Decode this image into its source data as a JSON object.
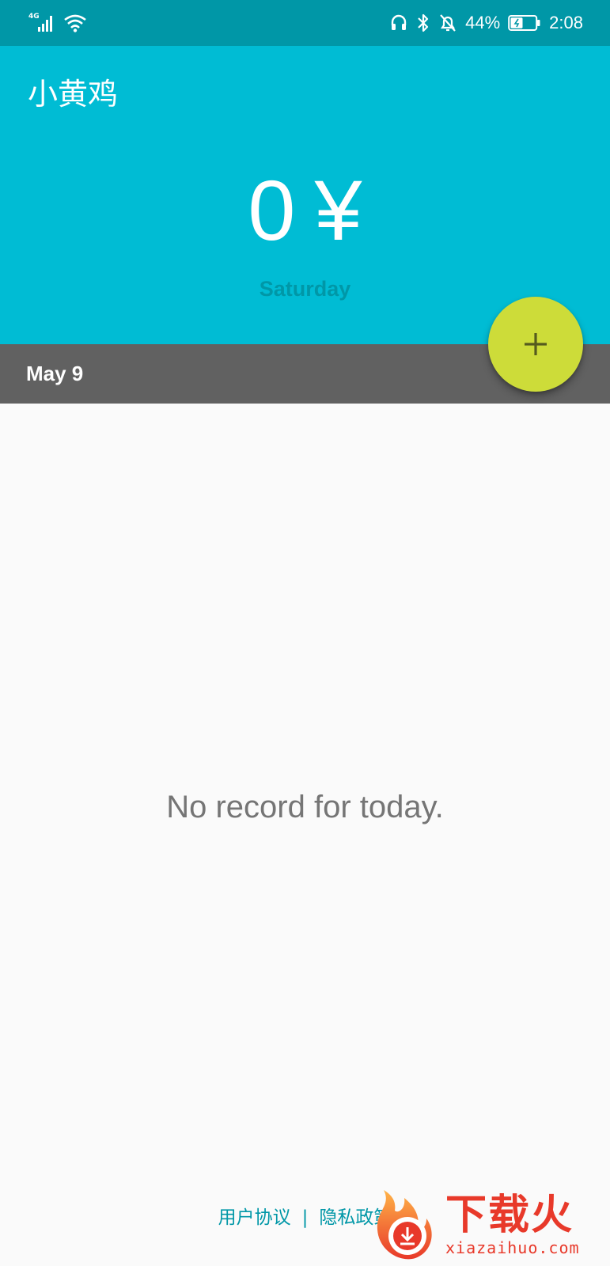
{
  "status_bar": {
    "network_type": "4G",
    "battery_percent": "44%",
    "time": "2:08",
    "icons": [
      "signal-icon",
      "wifi-icon",
      "headset-icon",
      "bluetooth-icon",
      "bell-off-icon",
      "battery-icon"
    ]
  },
  "header": {
    "app_title": "小黄鸡",
    "amount": "0",
    "currency_symbol": "¥",
    "weekday": "Saturday"
  },
  "date_bar": {
    "date": "May 9"
  },
  "fab": {
    "icon": "plus-icon"
  },
  "main": {
    "empty_message": "No record for today."
  },
  "footer": {
    "user_agreement": "用户协议",
    "separator": "|",
    "privacy_policy": "隐私政策"
  },
  "watermark": {
    "title": "下载火",
    "domain": "xiazaihuo.com"
  },
  "colors": {
    "primary": "#00bcd4",
    "primary_dark": "#0097a7",
    "accent": "#cddc39",
    "date_bar": "#616161",
    "background": "#fafafa",
    "empty_text": "#757575",
    "watermark": "#e8392a"
  }
}
